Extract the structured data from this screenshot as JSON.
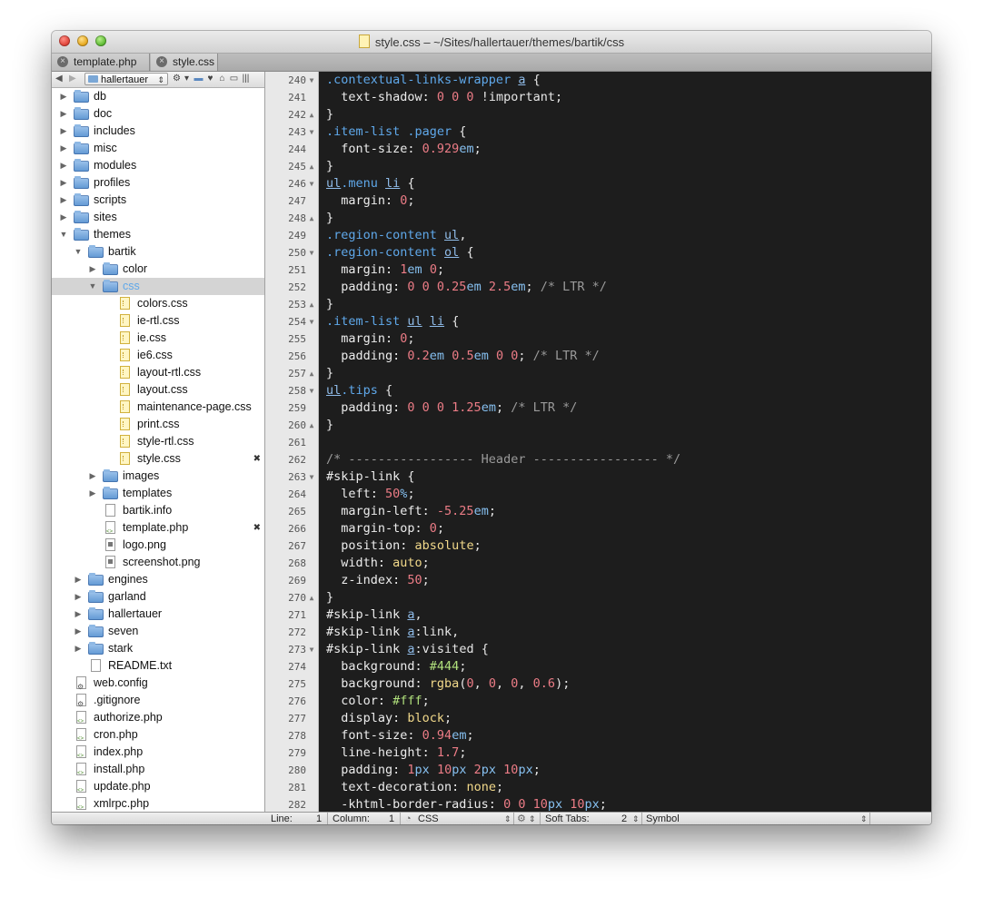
{
  "window": {
    "title": "style.css – ~/Sites/hallertauer/themes/bartik/css"
  },
  "tabs": [
    {
      "label": "template.php"
    },
    {
      "label": "style.css"
    }
  ],
  "sidebar": {
    "project": "hallertauer",
    "tree": [
      {
        "label": "db",
        "type": "folder",
        "depth": 0,
        "disclosure": "closed"
      },
      {
        "label": "doc",
        "type": "folder",
        "depth": 0,
        "disclosure": "closed"
      },
      {
        "label": "includes",
        "type": "folder",
        "depth": 0,
        "disclosure": "closed"
      },
      {
        "label": "misc",
        "type": "folder",
        "depth": 0,
        "disclosure": "closed"
      },
      {
        "label": "modules",
        "type": "folder",
        "depth": 0,
        "disclosure": "closed"
      },
      {
        "label": "profiles",
        "type": "folder",
        "depth": 0,
        "disclosure": "closed"
      },
      {
        "label": "scripts",
        "type": "folder",
        "depth": 0,
        "disclosure": "closed"
      },
      {
        "label": "sites",
        "type": "folder",
        "depth": 0,
        "disclosure": "closed"
      },
      {
        "label": "themes",
        "type": "folder",
        "depth": 0,
        "disclosure": "open"
      },
      {
        "label": "bartik",
        "type": "folder",
        "depth": 1,
        "disclosure": "open"
      },
      {
        "label": "color",
        "type": "folder",
        "depth": 2,
        "disclosure": "closed"
      },
      {
        "label": "css",
        "type": "folder",
        "depth": 2,
        "disclosure": "open",
        "selected": true
      },
      {
        "label": "colors.css",
        "type": "css",
        "depth": 3
      },
      {
        "label": "ie-rtl.css",
        "type": "css",
        "depth": 3
      },
      {
        "label": "ie.css",
        "type": "css",
        "depth": 3
      },
      {
        "label": "ie6.css",
        "type": "css",
        "depth": 3
      },
      {
        "label": "layout-rtl.css",
        "type": "css",
        "depth": 3
      },
      {
        "label": "layout.css",
        "type": "css",
        "depth": 3
      },
      {
        "label": "maintenance-page.css",
        "type": "css",
        "depth": 3
      },
      {
        "label": "print.css",
        "type": "css",
        "depth": 3
      },
      {
        "label": "style-rtl.css",
        "type": "css",
        "depth": 3
      },
      {
        "label": "style.css",
        "type": "css",
        "depth": 3,
        "open": true
      },
      {
        "label": "images",
        "type": "folder",
        "depth": 2,
        "disclosure": "closed"
      },
      {
        "label": "templates",
        "type": "folder",
        "depth": 2,
        "disclosure": "closed"
      },
      {
        "label": "bartik.info",
        "type": "file",
        "depth": 2
      },
      {
        "label": "template.php",
        "type": "php",
        "depth": 2,
        "open": true
      },
      {
        "label": "logo.png",
        "type": "img",
        "depth": 2
      },
      {
        "label": "screenshot.png",
        "type": "img",
        "depth": 2
      },
      {
        "label": "engines",
        "type": "folder",
        "depth": 1,
        "disclosure": "closed"
      },
      {
        "label": "garland",
        "type": "folder",
        "depth": 1,
        "disclosure": "closed"
      },
      {
        "label": "hallertauer",
        "type": "folder",
        "depth": 1,
        "disclosure": "closed"
      },
      {
        "label": "seven",
        "type": "folder",
        "depth": 1,
        "disclosure": "closed"
      },
      {
        "label": "stark",
        "type": "folder",
        "depth": 1,
        "disclosure": "closed"
      },
      {
        "label": "README.txt",
        "type": "file",
        "depth": 1
      },
      {
        "label": "web.config",
        "type": "cfg",
        "depth": 0
      },
      {
        "label": ".gitignore",
        "type": "cfg",
        "depth": 0
      },
      {
        "label": "authorize.php",
        "type": "php",
        "depth": 0
      },
      {
        "label": "cron.php",
        "type": "php",
        "depth": 0
      },
      {
        "label": "index.php",
        "type": "php",
        "depth": 0
      },
      {
        "label": "install.php",
        "type": "php",
        "depth": 0
      },
      {
        "label": "update.php",
        "type": "php",
        "depth": 0
      },
      {
        "label": "xmlrpc.php",
        "type": "php",
        "depth": 0
      }
    ]
  },
  "editor": {
    "lines": [
      {
        "n": "240",
        "fold": "▼",
        "tokens": [
          [
            ".contextual-links-wrapper ",
            "sel"
          ],
          [
            "a",
            "tag"
          ],
          [
            " {",
            "punc"
          ]
        ]
      },
      {
        "n": "241",
        "fold": "",
        "tokens": [
          [
            "  text-shadow: ",
            "prop"
          ],
          [
            "0 0 0",
            "num-v"
          ],
          [
            " !important;",
            "imp"
          ]
        ]
      },
      {
        "n": "242",
        "fold": "▲",
        "tokens": [
          [
            "}",
            "punc"
          ]
        ]
      },
      {
        "n": "243",
        "fold": "▼",
        "tokens": [
          [
            ".item-list .pager",
            "sel"
          ],
          [
            " {",
            "punc"
          ]
        ]
      },
      {
        "n": "244",
        "fold": "",
        "tokens": [
          [
            "  font-size: ",
            "prop"
          ],
          [
            "0.929",
            "num-v"
          ],
          [
            "em",
            "unit"
          ],
          [
            ";",
            "punc"
          ]
        ]
      },
      {
        "n": "245",
        "fold": "▲",
        "tokens": [
          [
            "}",
            "punc"
          ]
        ]
      },
      {
        "n": "246",
        "fold": "▼",
        "tokens": [
          [
            "ul",
            "tag"
          ],
          [
            ".menu ",
            "sel"
          ],
          [
            "li",
            "tag"
          ],
          [
            " {",
            "punc"
          ]
        ]
      },
      {
        "n": "247",
        "fold": "",
        "tokens": [
          [
            "  margin: ",
            "prop"
          ],
          [
            "0",
            "num-v"
          ],
          [
            ";",
            "punc"
          ]
        ]
      },
      {
        "n": "248",
        "fold": "▲",
        "tokens": [
          [
            "}",
            "punc"
          ]
        ]
      },
      {
        "n": "249",
        "fold": "",
        "tokens": [
          [
            ".region-content ",
            "sel"
          ],
          [
            "ul",
            "tag"
          ],
          [
            ",",
            "punc"
          ]
        ]
      },
      {
        "n": "250",
        "fold": "▼",
        "tokens": [
          [
            ".region-content ",
            "sel"
          ],
          [
            "ol",
            "tag"
          ],
          [
            " {",
            "punc"
          ]
        ]
      },
      {
        "n": "251",
        "fold": "",
        "tokens": [
          [
            "  margin: ",
            "prop"
          ],
          [
            "1",
            "num-v"
          ],
          [
            "em",
            "unit"
          ],
          [
            " ",
            "punc"
          ],
          [
            "0",
            "num-v"
          ],
          [
            ";",
            "punc"
          ]
        ]
      },
      {
        "n": "252",
        "fold": "",
        "tokens": [
          [
            "  padding: ",
            "prop"
          ],
          [
            "0 0 0.25",
            "num-v"
          ],
          [
            "em",
            "unit"
          ],
          [
            " ",
            "punc"
          ],
          [
            "2.5",
            "num-v"
          ],
          [
            "em",
            "unit"
          ],
          [
            "; ",
            "punc"
          ],
          [
            "/* LTR */",
            "cmt"
          ]
        ]
      },
      {
        "n": "253",
        "fold": "▲",
        "tokens": [
          [
            "}",
            "punc"
          ]
        ]
      },
      {
        "n": "254",
        "fold": "▼",
        "tokens": [
          [
            ".item-list ",
            "sel"
          ],
          [
            "ul",
            "tag"
          ],
          [
            " ",
            "punc"
          ],
          [
            "li",
            "tag"
          ],
          [
            " {",
            "punc"
          ]
        ]
      },
      {
        "n": "255",
        "fold": "",
        "tokens": [
          [
            "  margin: ",
            "prop"
          ],
          [
            "0",
            "num-v"
          ],
          [
            ";",
            "punc"
          ]
        ]
      },
      {
        "n": "256",
        "fold": "",
        "tokens": [
          [
            "  padding: ",
            "prop"
          ],
          [
            "0.2",
            "num-v"
          ],
          [
            "em",
            "unit"
          ],
          [
            " ",
            "punc"
          ],
          [
            "0.5",
            "num-v"
          ],
          [
            "em",
            "unit"
          ],
          [
            " ",
            "punc"
          ],
          [
            "0 0",
            "num-v"
          ],
          [
            "; ",
            "punc"
          ],
          [
            "/* LTR */",
            "cmt"
          ]
        ]
      },
      {
        "n": "257",
        "fold": "▲",
        "tokens": [
          [
            "}",
            "punc"
          ]
        ]
      },
      {
        "n": "258",
        "fold": "▼",
        "tokens": [
          [
            "ul",
            "tag"
          ],
          [
            ".tips",
            "sel"
          ],
          [
            " {",
            "punc"
          ]
        ]
      },
      {
        "n": "259",
        "fold": "",
        "tokens": [
          [
            "  padding: ",
            "prop"
          ],
          [
            "0 0 0 1.25",
            "num-v"
          ],
          [
            "em",
            "unit"
          ],
          [
            "; ",
            "punc"
          ],
          [
            "/* LTR */",
            "cmt"
          ]
        ]
      },
      {
        "n": "260",
        "fold": "▲",
        "tokens": [
          [
            "}",
            "punc"
          ]
        ]
      },
      {
        "n": "261",
        "fold": "",
        "tokens": []
      },
      {
        "n": "262",
        "fold": "",
        "tokens": [
          [
            "/* ----------------- Header ----------------- */",
            "cmt"
          ]
        ]
      },
      {
        "n": "263",
        "fold": "▼",
        "tokens": [
          [
            "#skip-link",
            "prop"
          ],
          [
            " {",
            "punc"
          ]
        ]
      },
      {
        "n": "264",
        "fold": "",
        "tokens": [
          [
            "  left: ",
            "prop"
          ],
          [
            "50",
            "num-v"
          ],
          [
            "%",
            "unit"
          ],
          [
            ";",
            "punc"
          ]
        ]
      },
      {
        "n": "265",
        "fold": "",
        "tokens": [
          [
            "  margin-left: ",
            "prop"
          ],
          [
            "-5.25",
            "num-v"
          ],
          [
            "em",
            "unit"
          ],
          [
            ";",
            "punc"
          ]
        ]
      },
      {
        "n": "266",
        "fold": "",
        "tokens": [
          [
            "  margin-top: ",
            "prop"
          ],
          [
            "0",
            "num-v"
          ],
          [
            ";",
            "punc"
          ]
        ]
      },
      {
        "n": "267",
        "fold": "",
        "tokens": [
          [
            "  position: ",
            "prop"
          ],
          [
            "absolute",
            "kw"
          ],
          [
            ";",
            "punc"
          ]
        ]
      },
      {
        "n": "268",
        "fold": "",
        "tokens": [
          [
            "  width: ",
            "prop"
          ],
          [
            "auto",
            "kw"
          ],
          [
            ";",
            "punc"
          ]
        ]
      },
      {
        "n": "269",
        "fold": "",
        "tokens": [
          [
            "  z-index: ",
            "prop"
          ],
          [
            "50",
            "num-v"
          ],
          [
            ";",
            "punc"
          ]
        ]
      },
      {
        "n": "270",
        "fold": "▲",
        "tokens": [
          [
            "}",
            "punc"
          ]
        ]
      },
      {
        "n": "271",
        "fold": "",
        "tokens": [
          [
            "#skip-link ",
            "prop"
          ],
          [
            "a",
            "tag"
          ],
          [
            ",",
            "punc"
          ]
        ]
      },
      {
        "n": "272",
        "fold": "",
        "tokens": [
          [
            "#skip-link ",
            "prop"
          ],
          [
            "a",
            "tag"
          ],
          [
            ":link,",
            "punc"
          ]
        ]
      },
      {
        "n": "273",
        "fold": "▼",
        "tokens": [
          [
            "#skip-link ",
            "prop"
          ],
          [
            "a",
            "tag"
          ],
          [
            ":visited {",
            "punc"
          ]
        ]
      },
      {
        "n": "274",
        "fold": "",
        "tokens": [
          [
            "  background: ",
            "prop"
          ],
          [
            "#444",
            "hex"
          ],
          [
            ";",
            "punc"
          ]
        ]
      },
      {
        "n": "275",
        "fold": "",
        "tokens": [
          [
            "  background: ",
            "prop"
          ],
          [
            "rgba",
            "fn"
          ],
          [
            "(",
            "punc"
          ],
          [
            "0",
            "num-v"
          ],
          [
            ", ",
            "punc"
          ],
          [
            "0",
            "num-v"
          ],
          [
            ", ",
            "punc"
          ],
          [
            "0",
            "num-v"
          ],
          [
            ", ",
            "punc"
          ],
          [
            "0.6",
            "num-v"
          ],
          [
            ");",
            "punc"
          ]
        ]
      },
      {
        "n": "276",
        "fold": "",
        "tokens": [
          [
            "  color: ",
            "prop"
          ],
          [
            "#fff",
            "hex"
          ],
          [
            ";",
            "punc"
          ]
        ]
      },
      {
        "n": "277",
        "fold": "",
        "tokens": [
          [
            "  display: ",
            "prop"
          ],
          [
            "block",
            "kw"
          ],
          [
            ";",
            "punc"
          ]
        ]
      },
      {
        "n": "278",
        "fold": "",
        "tokens": [
          [
            "  font-size: ",
            "prop"
          ],
          [
            "0.94",
            "num-v"
          ],
          [
            "em",
            "unit"
          ],
          [
            ";",
            "punc"
          ]
        ]
      },
      {
        "n": "279",
        "fold": "",
        "tokens": [
          [
            "  line-height: ",
            "prop"
          ],
          [
            "1.7",
            "num-v"
          ],
          [
            ";",
            "punc"
          ]
        ]
      },
      {
        "n": "280",
        "fold": "",
        "tokens": [
          [
            "  padding: ",
            "prop"
          ],
          [
            "1",
            "num-v"
          ],
          [
            "px",
            "unit"
          ],
          [
            " ",
            "punc"
          ],
          [
            "10",
            "num-v"
          ],
          [
            "px",
            "unit"
          ],
          [
            " ",
            "punc"
          ],
          [
            "2",
            "num-v"
          ],
          [
            "px",
            "unit"
          ],
          [
            " ",
            "punc"
          ],
          [
            "10",
            "num-v"
          ],
          [
            "px",
            "unit"
          ],
          [
            ";",
            "punc"
          ]
        ]
      },
      {
        "n": "281",
        "fold": "",
        "tokens": [
          [
            "  text-decoration: ",
            "prop"
          ],
          [
            "none",
            "kw"
          ],
          [
            ";",
            "punc"
          ]
        ]
      },
      {
        "n": "282",
        "fold": "",
        "tokens": [
          [
            "  -khtml-border-radius: ",
            "prop"
          ],
          [
            "0 0 10",
            "num-v"
          ],
          [
            "px",
            "unit"
          ],
          [
            " ",
            "punc"
          ],
          [
            "10",
            "num-v"
          ],
          [
            "px",
            "unit"
          ],
          [
            ";",
            "punc"
          ]
        ]
      }
    ]
  },
  "status": {
    "line_label": "Line:",
    "line_value": "1",
    "column_label": "Column:",
    "column_value": "1",
    "language": "CSS",
    "tabs_label": "Soft Tabs:",
    "tabs_value": "2",
    "symbol": "Symbol"
  }
}
